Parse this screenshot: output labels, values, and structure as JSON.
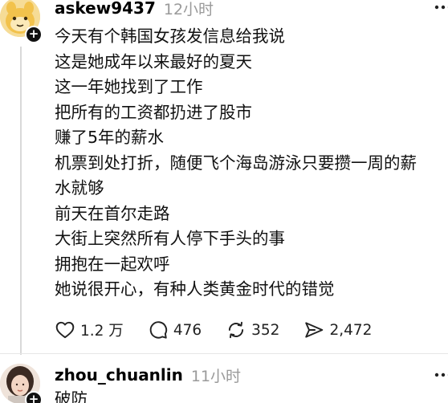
{
  "posts": [
    {
      "username": "askew9437",
      "time": "12小时",
      "lines": [
        "今天有个韩国女孩发信息给我说",
        "这是她成年以来最好的夏天",
        "这一年她找到了工作",
        "把所有的工资都扔进了股市",
        "赚了5年的薪水",
        "机票到处打折，随便飞个海岛游泳只要攒一周的薪",
        "水就够",
        "前天在首尔走路",
        "大街上突然所有人停下手头的事",
        "拥抱在一起欢呼",
        "她说很开心，有种人类黄金时代的错觉"
      ],
      "stats": {
        "likes": "1.2 万",
        "replies": "476",
        "reposts": "352",
        "shares": "2,472"
      }
    },
    {
      "username": "zhou_chuanlin",
      "time": "11小时",
      "text": "破防"
    }
  ],
  "icons": {
    "like": "heart-icon",
    "reply": "comment-bubble-icon",
    "repost": "repost-arrows-icon",
    "share": "send-arrow-icon",
    "more": "more-dots-icon",
    "follow": "plus-icon"
  },
  "colors": {
    "text": "#101010",
    "muted": "#9a9a9a",
    "divider": "#e6e6e6"
  }
}
